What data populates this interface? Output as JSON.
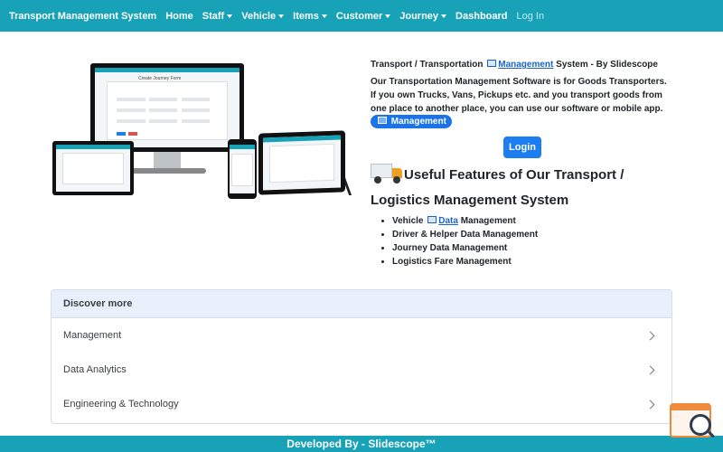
{
  "navbar": {
    "brand": "Transport Management System",
    "items": [
      {
        "label": "Home",
        "dropdown": false
      },
      {
        "label": "Staff",
        "dropdown": true
      },
      {
        "label": "Vehicle",
        "dropdown": true
      },
      {
        "label": "Items",
        "dropdown": true
      },
      {
        "label": "Customer",
        "dropdown": true
      },
      {
        "label": "Journey",
        "dropdown": true
      },
      {
        "label": "Dashboard",
        "dropdown": false
      },
      {
        "label": "Log In",
        "dropdown": false
      }
    ]
  },
  "hero": {
    "screen_title": "Create Journey Form",
    "title_prefix": "Transport / Transportation",
    "title_link": "Management",
    "title_suffix": "System - By Slidescope",
    "description": "Our Transportation Management Software is for Goods Transporters. If you own Trucks, Vans, Pickups etc. and you transport goods from one place to another place, you can use our software or mobile app.",
    "pill_label": "Management",
    "login_label": "Login"
  },
  "features": {
    "title": "Useful Features of Our Transport / Logistics Management System",
    "items": [
      {
        "prefix": "Vehicle",
        "link": "Data",
        "suffix": "Management"
      },
      {
        "text": "Driver & Helper Data Management"
      },
      {
        "text": "Journey Data Management"
      },
      {
        "text": "Logistics Fare Management"
      }
    ]
  },
  "discover": {
    "heading": "Discover more",
    "items": [
      "Management",
      "Data Analytics",
      "Engineering & Technology"
    ]
  },
  "footer": {
    "text": "Developed By - Slidescope™"
  },
  "colors": {
    "navbar": "#17a2b8",
    "primary_button": "#1c7ef0",
    "link": "#1c63c9",
    "discover_header": "#e8f0fb"
  },
  "icons": {
    "nav_caret": "chevron-down-icon",
    "doc": "document-icon",
    "truck": "truck-icon",
    "row_chevron": "chevron-right-icon",
    "widget": "search-widget-icon"
  }
}
